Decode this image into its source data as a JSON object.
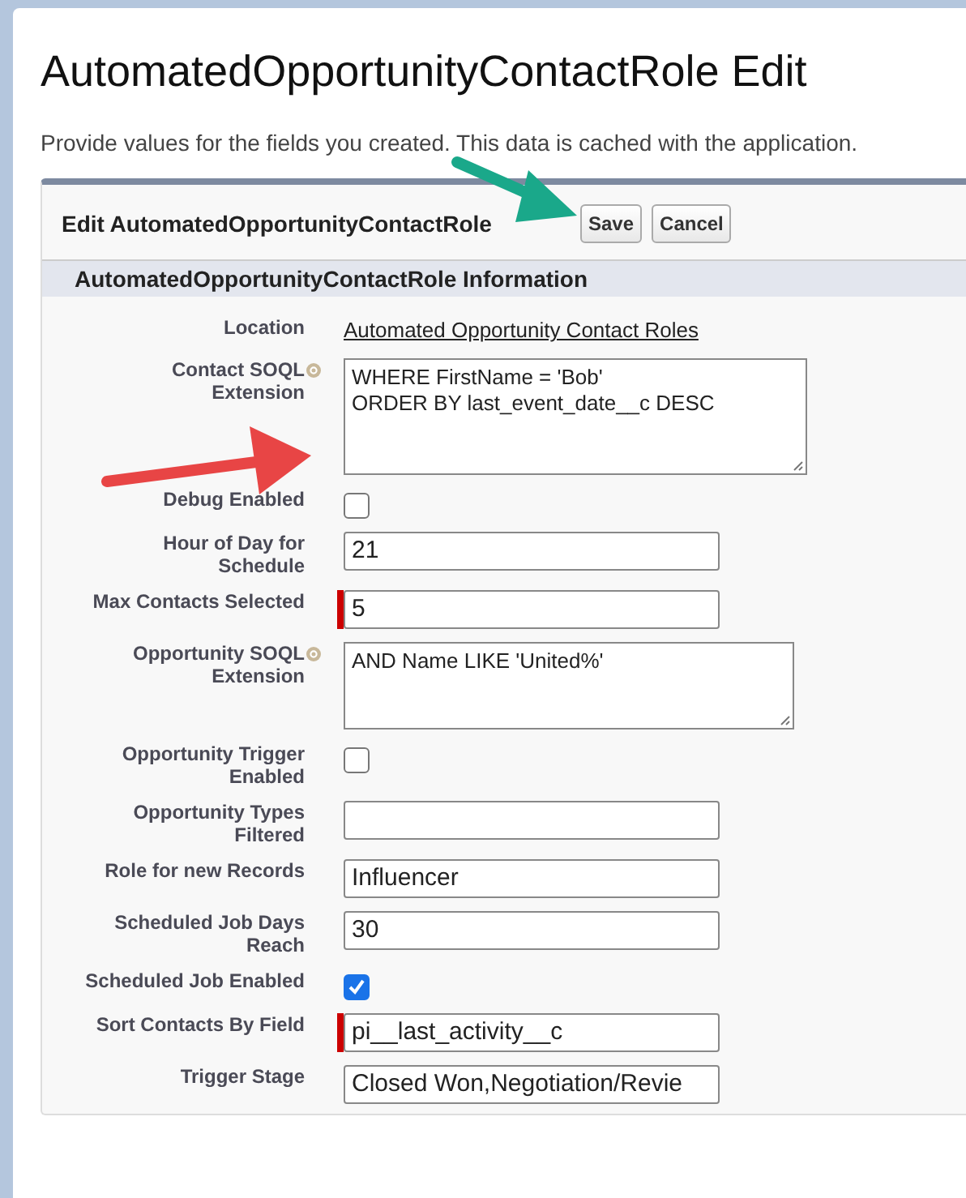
{
  "page": {
    "title": "AutomatedOpportunityContactRole Edit",
    "description": "Provide values for the fields you created. This data is cached with the application."
  },
  "edit_block": {
    "title": "Edit AutomatedOpportunityContactRole",
    "buttons": [
      "Save",
      "Cancel"
    ],
    "section_title": "AutomatedOpportunityContactRole Information"
  },
  "fields": [
    {
      "label": "Location",
      "kind": "link",
      "value": "Automated Opportunity Contact Roles"
    },
    {
      "label": "Contact SOQL Extension",
      "kind": "textarea",
      "value": "WHERE FirstName = 'Bob'\nORDER BY last_event_date__c DESC",
      "help": true
    },
    {
      "label": "Debug Enabled",
      "kind": "checkbox",
      "checked": false
    },
    {
      "label": "Hour of Day for Schedule",
      "kind": "text",
      "value": "21"
    },
    {
      "label": "Max Contacts Selected",
      "kind": "text",
      "value": "5",
      "required": true
    },
    {
      "label": "Opportunity SOQL Extension",
      "kind": "textarea",
      "value": "AND Name LIKE 'United%'",
      "help": true
    },
    {
      "label": "Opportunity Trigger Enabled",
      "kind": "checkbox",
      "checked": false
    },
    {
      "label": "Opportunity Types Filtered",
      "kind": "text"
    },
    {
      "label": "Role for new Records",
      "kind": "text",
      "value": "Influencer"
    },
    {
      "label": "Scheduled Job Days Reach",
      "kind": "text",
      "value": "30"
    },
    {
      "label": "Scheduled Job Enabled",
      "kind": "checkbox",
      "checked": true
    },
    {
      "label": "Sort Contacts By Field",
      "kind": "text",
      "value": "pi__last_activity__c",
      "required": true
    },
    {
      "label": "Trigger Stage",
      "kind": "text",
      "value": "Closed Won,Negotiation/Revie"
    }
  ]
}
